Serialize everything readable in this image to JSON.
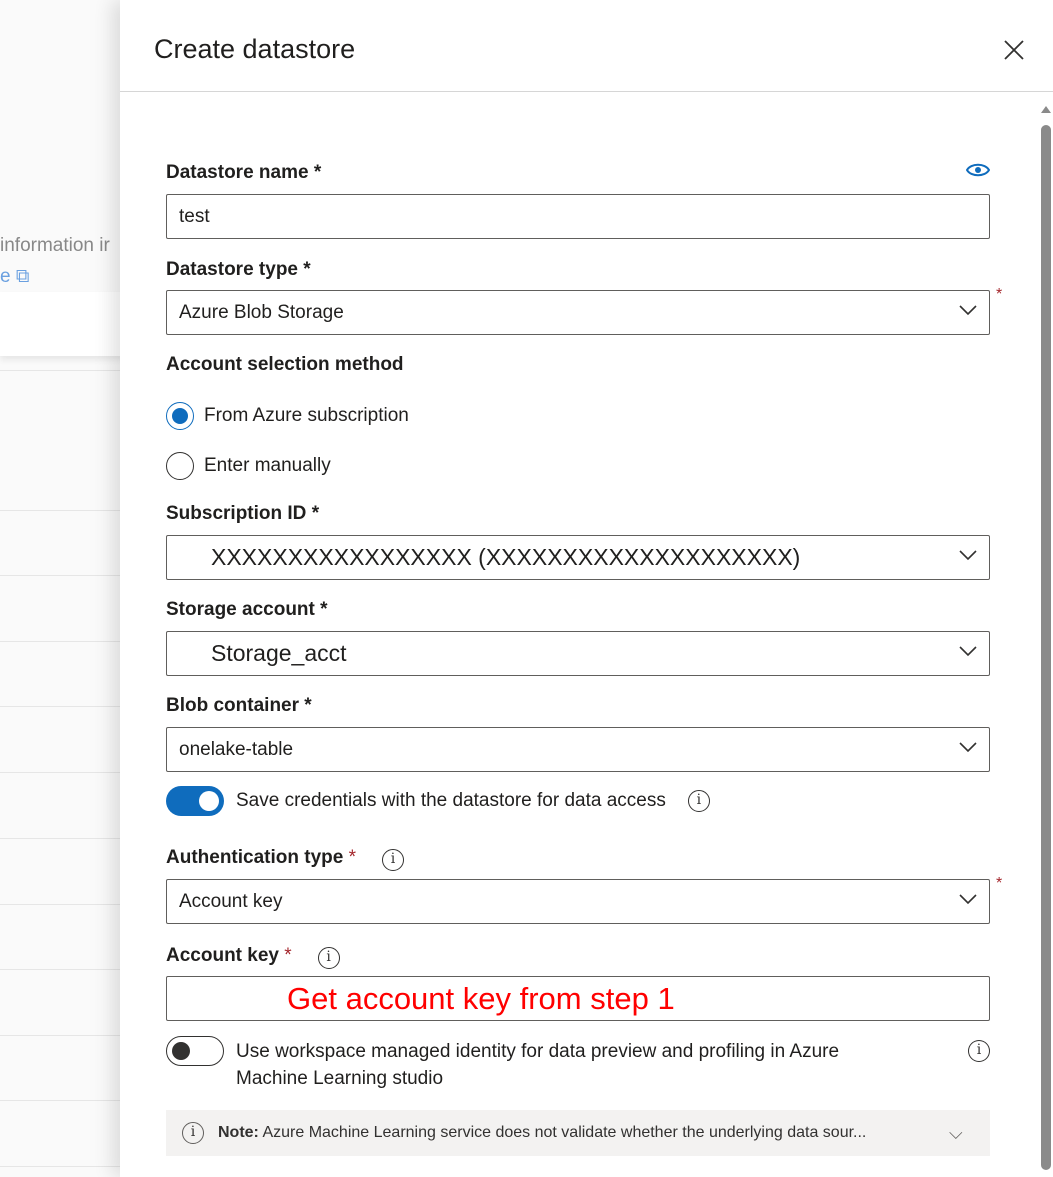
{
  "background": {
    "info_text": "information ir",
    "link_text": "e"
  },
  "panel": {
    "title": "Create datastore",
    "datastore_name": {
      "label": "Datastore name",
      "required": "*",
      "value": "test"
    },
    "datastore_type": {
      "label": "Datastore type",
      "required": "*",
      "value": "Azure Blob Storage"
    },
    "account_selection": {
      "label": "Account selection method",
      "options": [
        "From Azure subscription",
        "Enter manually"
      ],
      "selected": "From Azure subscription"
    },
    "subscription_id": {
      "label": "Subscription ID",
      "required": "*",
      "value": "XXXXXXXXXXXXXXXXX (XXXXXXXXXXXXXXXXXXXX)"
    },
    "storage_account": {
      "label": "Storage account",
      "required": "*",
      "value": "Storage_acct"
    },
    "blob_container": {
      "label": "Blob container",
      "required": "*",
      "value": "onelake-table"
    },
    "save_credentials": {
      "label": "Save credentials with the datastore for data access",
      "on": true
    },
    "auth_type": {
      "label": "Authentication type",
      "required": "*",
      "value": "Account key"
    },
    "account_key": {
      "label": "Account key",
      "required": "*",
      "annotation": "Get account key from step 1"
    },
    "managed_identity": {
      "label": "Use workspace managed identity for data preview and profiling in Azure Machine Learning studio",
      "on": false
    },
    "note": {
      "prefix": "Note:",
      "text": " Azure Machine Learning service does not validate whether the underlying data sour..."
    }
  },
  "colors": {
    "accent": "#0f6cbd",
    "required": "#a4262c",
    "annotation": "#ff0000"
  }
}
